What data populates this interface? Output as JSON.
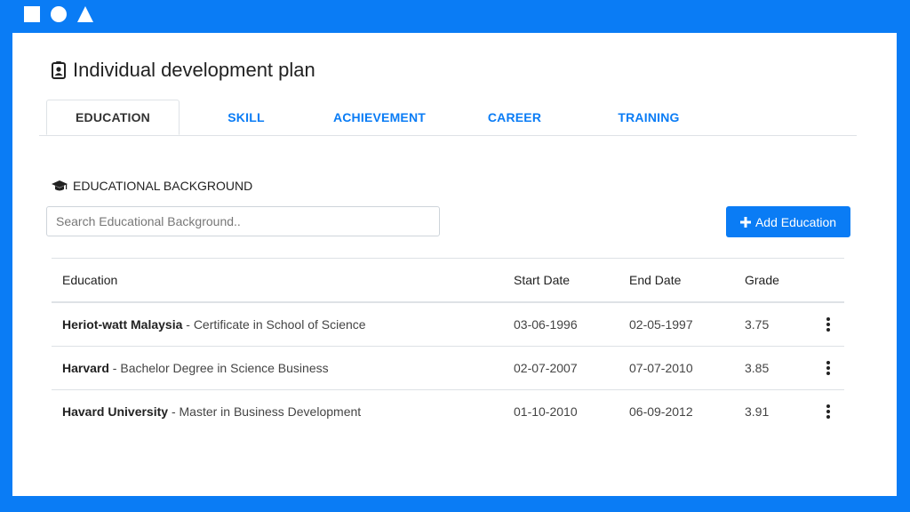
{
  "page": {
    "title": "Individual development plan",
    "title_icon": "id-badge-icon"
  },
  "tabs": [
    {
      "label": "EDUCATION",
      "active": true
    },
    {
      "label": "SKILL",
      "active": false
    },
    {
      "label": "ACHIEVEMENT",
      "active": false
    },
    {
      "label": "CAREER",
      "active": false
    },
    {
      "label": "TRAINING",
      "active": false
    }
  ],
  "section": {
    "title": "EDUCATIONAL BACKGROUND",
    "icon": "graduation-cap-icon"
  },
  "search": {
    "placeholder": "Search Educational Background..",
    "value": ""
  },
  "add_button": {
    "label": "Add Education",
    "icon": "plus-icon"
  },
  "table": {
    "headers": {
      "education": "Education",
      "start": "Start Date",
      "end": "End Date",
      "grade": "Grade"
    },
    "rows": [
      {
        "institution": "Heriot-watt Malaysia",
        "program": " - Certificate in School of Science",
        "start": "03-06-1996",
        "end": "02-05-1997",
        "grade": "3.75"
      },
      {
        "institution": "Harvard",
        "program": " - Bachelor Degree in Science Business",
        "start": "02-07-2007",
        "end": "07-07-2010",
        "grade": "3.85"
      },
      {
        "institution": "Havard University",
        "program": " - Master in Business Development",
        "start": "01-10-2010",
        "end": "06-09-2012",
        "grade": "3.91"
      }
    ]
  },
  "colors": {
    "accent": "#0a7cf5",
    "frame": "#0a7cf5"
  }
}
